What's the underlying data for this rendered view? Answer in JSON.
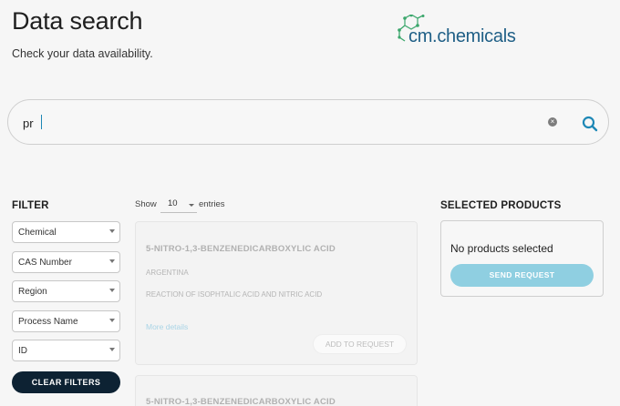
{
  "header": {
    "title": "Data search",
    "subtitle": "Check your data availability."
  },
  "logo": {
    "text": "cm.chemicals",
    "icon": "molecule-logo-icon"
  },
  "search": {
    "value": "pr",
    "clear_icon": "clear-icon",
    "search_icon": "search-icon"
  },
  "filter": {
    "heading": "FILTER",
    "selects": [
      "Chemical",
      "CAS Number",
      "Region",
      "Process Name",
      "ID"
    ],
    "clear_label": "CLEAR FILTERS"
  },
  "table": {
    "show_label": "Show",
    "entries_value": "10",
    "entries_label": "entries"
  },
  "results": [
    {
      "title": "5-NITRO-1,3-BENZENEDICARBOXYLIC ACID",
      "country": "ARGENTINA",
      "process": "REACTION OF ISOPHTALIC ACID AND NITRIC ACID",
      "more": "More details",
      "add": "ADD TO REQUEST"
    },
    {
      "title": "5-NITRO-1,3-BENZENEDICARBOXYLIC ACID"
    }
  ],
  "selected": {
    "heading": "SELECTED PRODUCTS",
    "empty_text": "No products selected",
    "send_label": "SEND REQUEST"
  },
  "colors": {
    "accent": "#8fcfe1",
    "dark_button": "#0d2233",
    "logo_blue": "#1f5f86",
    "logo_green": "#3aa66b"
  }
}
